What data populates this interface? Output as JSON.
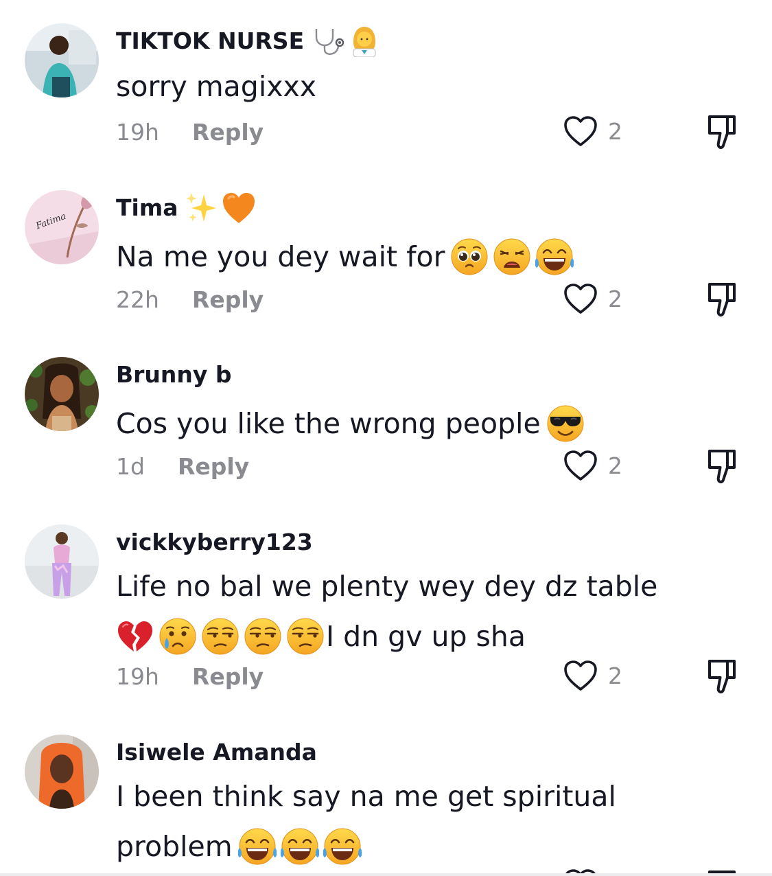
{
  "comments": [
    {
      "username": "TIKTOK NURSE",
      "username_badge_icons": [
        "stethoscope-icon",
        "woman-health-worker-emoji"
      ],
      "text": "sorry magixxx",
      "text_emoji_icons": [],
      "time": "19h",
      "reply_label": "Reply",
      "likes": "2"
    },
    {
      "username": "Tima",
      "username_badge_icons": [
        "sparkles-emoji",
        "orange-heart-emoji"
      ],
      "text": "Na me you dey wait for",
      "text_emoji_icons": [
        "pleading-face-emoji",
        "weary-face-emoji",
        "tears-of-joy-emoji"
      ],
      "avatar_text": "Fatima",
      "time": "22h",
      "reply_label": "Reply",
      "likes": "2"
    },
    {
      "username": "Brunny b",
      "username_badge_icons": [],
      "text": "Cos you like the wrong people",
      "text_emoji_icons": [
        "sunglasses-face-emoji"
      ],
      "time": "1d",
      "reply_label": "Reply",
      "likes": "2"
    },
    {
      "username": "vickkyberry123",
      "username_badge_icons": [],
      "text_line1": "Life no bal we plenty wey dey dz table",
      "text_line2_emoji_icons": [
        "broken-heart-emoji",
        "crying-face-emoji",
        "unamused-face-emoji",
        "unamused-face-emoji",
        "unamused-face-emoji"
      ],
      "text_line2": "I dn gv up sha",
      "time": "19h",
      "reply_label": "Reply",
      "likes": "2"
    },
    {
      "username": "Isiwele Amanda",
      "username_badge_icons": [],
      "text_line1": "I been think say na me get spiritual",
      "text_line2": "problem",
      "text_line2_emoji_icons": [
        "tears-of-joy-emoji",
        "tears-of-joy-emoji",
        "tears-of-joy-emoji"
      ]
    }
  ],
  "colors": {
    "primary_text": "#161823",
    "secondary_text": "#8a8b91",
    "background": "#ffffff",
    "icon_stroke": "#161823"
  }
}
